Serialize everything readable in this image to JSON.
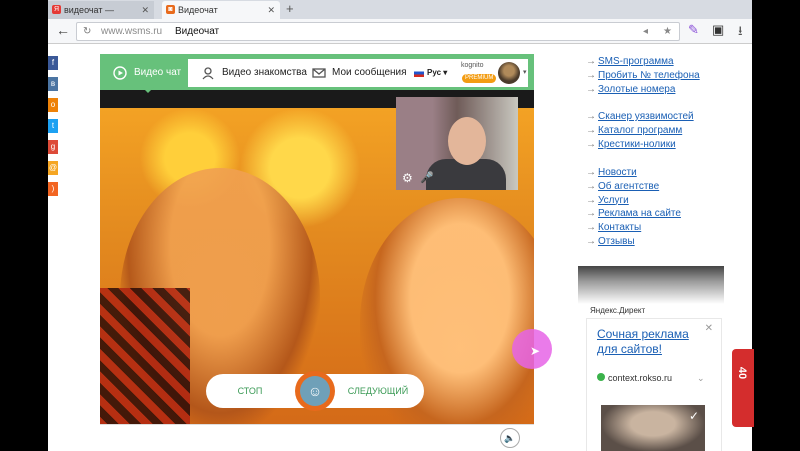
{
  "browser": {
    "tabs": [
      {
        "title": "видеочат — Яндекс:..."
      },
      {
        "title": "Видеочат"
      }
    ],
    "new_tab": "+",
    "url_host": "www.wsms.ru",
    "page_title": "Видеочат"
  },
  "social_icons": [
    "facebook-icon",
    "vk-icon",
    "odnoklassniki-icon",
    "twitter-icon",
    "googleplus-icon",
    "mailru-icon",
    "rss-icon"
  ],
  "chat": {
    "nav": [
      {
        "label": "Видео чат"
      },
      {
        "label": "Видео знакомства"
      },
      {
        "label": "Мои сообщения"
      }
    ],
    "language": "Рус",
    "user_label": "kognito",
    "premium": "PREMIUM",
    "stop_label": "СТОП",
    "next_label": "СЛЕДУЮЩИЙ"
  },
  "menu_groups": [
    [
      "SMS-программа",
      "Пробить № телефона",
      "Золотые номера"
    ],
    [
      "Сканер уязвимостей",
      "Каталог программ",
      "Крестики-нолики"
    ],
    [
      "Новости",
      "Об агентстве",
      "Услуги",
      "Реклама на сайте",
      "Контакты",
      "Отзывы"
    ]
  ],
  "ad": {
    "label": "Яндекс.Директ",
    "title": "Сочная реклама для сайтов!",
    "url": "context.rokso.ru"
  },
  "side_tab": "40",
  "colors": {
    "accent": "#67c17b",
    "link": "#1a5fb4",
    "orange": "#e86a1c"
  }
}
